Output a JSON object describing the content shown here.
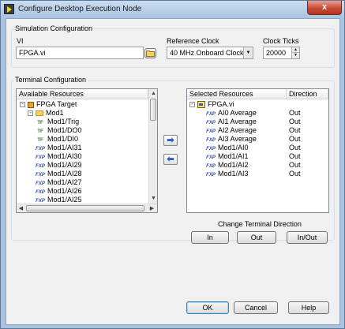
{
  "window": {
    "title": "Configure Desktop Execution Node",
    "close_glyph": "x"
  },
  "simulation": {
    "group_title": "Simulation Configuration",
    "vi_label": "VI",
    "vi_value": "FPGA.vi",
    "ref_clock_label": "Reference Clock",
    "ref_clock_value": "40 MHz Onboard Clock",
    "clock_ticks_label": "Clock Ticks",
    "clock_ticks_value": "20000"
  },
  "terminal": {
    "group_title": "Terminal Configuration",
    "available": {
      "header": "Available Resources",
      "items": [
        {
          "expander": "-",
          "icon": "fpga-target-icon",
          "tag": "",
          "label": "FPGA Target",
          "indent": 0
        },
        {
          "expander": "-",
          "icon": "folder-icon",
          "tag": "",
          "label": "Mod1",
          "indent": 1
        },
        {
          "expander": "",
          "icon": "",
          "tag": "TF",
          "label": "Mod1/Trig",
          "indent": 2
        },
        {
          "expander": "",
          "icon": "",
          "tag": "TF",
          "label": "Mod1/DO0",
          "indent": 2
        },
        {
          "expander": "",
          "icon": "",
          "tag": "TF",
          "label": "Mod1/DI0",
          "indent": 2
        },
        {
          "expander": "",
          "icon": "",
          "tag": "FXP",
          "label": "Mod1/AI31",
          "indent": 2
        },
        {
          "expander": "",
          "icon": "",
          "tag": "FXP",
          "label": "Mod1/AI30",
          "indent": 2
        },
        {
          "expander": "",
          "icon": "",
          "tag": "FXP",
          "label": "Mod1/AI29",
          "indent": 2
        },
        {
          "expander": "",
          "icon": "",
          "tag": "FXP",
          "label": "Mod1/AI28",
          "indent": 2
        },
        {
          "expander": "",
          "icon": "",
          "tag": "FXP",
          "label": "Mod1/AI27",
          "indent": 2
        },
        {
          "expander": "",
          "icon": "",
          "tag": "FXP",
          "label": "Mod1/AI26",
          "indent": 2
        },
        {
          "expander": "",
          "icon": "",
          "tag": "FXP",
          "label": "Mod1/AI25",
          "indent": 2
        }
      ]
    },
    "selected": {
      "header_resources": "Selected Resources",
      "header_direction": "Direction",
      "root": {
        "expander": "-",
        "label": "FPGA.vi"
      },
      "items": [
        {
          "tag": "FXP",
          "label": "AI0 Average",
          "direction": "Out"
        },
        {
          "tag": "FXP",
          "label": "AI1 Average",
          "direction": "Out"
        },
        {
          "tag": "FXP",
          "label": "AI2 Average",
          "direction": "Out"
        },
        {
          "tag": "FXP",
          "label": "AI3 Average",
          "direction": "Out"
        },
        {
          "tag": "FXP",
          "label": "Mod1/AI0",
          "direction": "Out"
        },
        {
          "tag": "FXP",
          "label": "Mod1/AI1",
          "direction": "Out"
        },
        {
          "tag": "FXP",
          "label": "Mod1/AI2",
          "direction": "Out"
        },
        {
          "tag": "FXP",
          "label": "Mod1/AI3",
          "direction": "Out"
        }
      ]
    },
    "add_arrow": "➡",
    "remove_arrow": "⬅",
    "change_direction_label": "Change Terminal Direction",
    "dir_buttons": {
      "in": "In",
      "out": "Out",
      "inout": "In/Out"
    }
  },
  "footer": {
    "ok": "OK",
    "cancel": "Cancel",
    "help": "Help"
  }
}
